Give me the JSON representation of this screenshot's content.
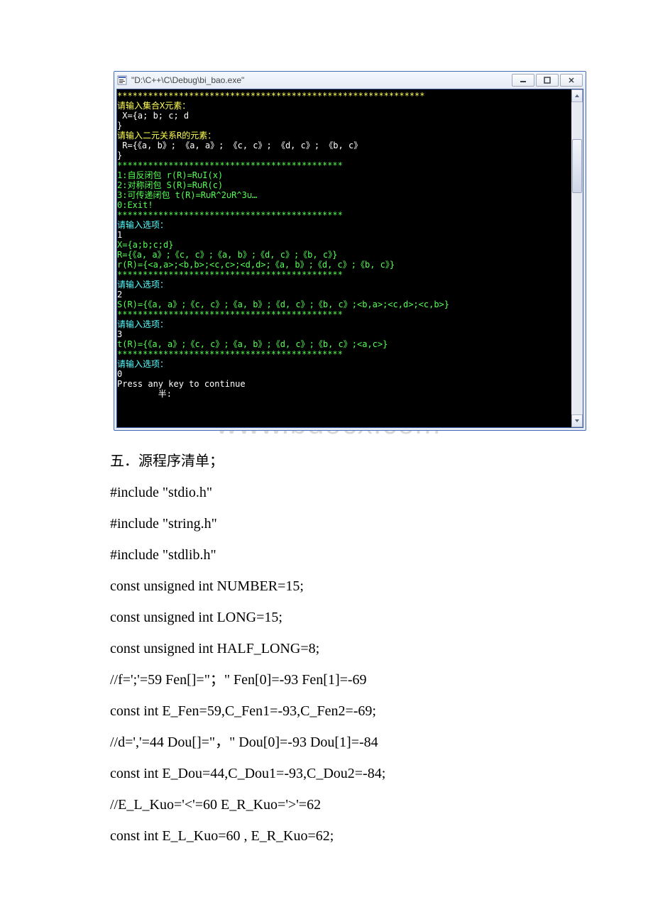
{
  "window": {
    "title": "\"D:\\C++\\C\\Debug\\bi_bao.exe\""
  },
  "console": {
    "l1": "************************************************************",
    "l2": "请输入集合X元素：",
    "l3": " X={a; b; c; d",
    "l4": "}",
    "l5": "请输入二元关系R的元素：",
    "l6": " R={《a, b》; 《a, a》; 《c, c》; 《d, c》; 《b, c》",
    "l7": "}",
    "l8": "********************************************",
    "l9": "1:自反闭包 r(R)=R∪I(x)",
    "l10": "2:对称闭包 S(R)=R∪R(c)",
    "l11": "3:可传递闭包 t(R)=R∪R^2∪R^3∪…",
    "l12": "0:Exit!",
    "l13": "********************************************",
    "l14": "请输入选项：",
    "l15": "1",
    "l16": "X={a;b;c;d}",
    "l17": "R={《a, a》;《c, c》;《a, b》;《d, c》;《b, c》}",
    "l18": "r(R)={<a,a>;<b,b>;<c,c>;<d,d>;《a, b》;《d, c》;《b, c》}",
    "l19": "********************************************",
    "l20": "请输入选项：",
    "l21": "2",
    "l22": "S(R)={《a, a》;《c, c》;《a, b》;《d, c》;《b, c》;<b,a>;<c,d>;<c,b>}",
    "l23": "********************************************",
    "l24": "请输入选项：",
    "l25": "3",
    "l26": "t(R)={《a, a》;《c, c》;《a, b》;《d, c》;《b, c》;<a,c>}",
    "l27": "********************************************",
    "l28": "请输入选项：",
    "l29": "0",
    "l30": "Press any key to continue",
    "l31": "        半:"
  },
  "watermark": "www.bdocx.com",
  "doc": {
    "heading": "五．源程序清单；",
    "p1": "#include \"stdio.h\"",
    "p2": "#include \"string.h\"",
    "p3": "#include \"stdlib.h\"",
    "p4": "const unsigned int NUMBER=15;",
    "p5": "const unsigned int LONG=15;",
    "p6": "const unsigned int HALF_LONG=8;",
    "p7": "//f=';'=59 Fen[]=\"；\" Fen[0]=-93 Fen[1]=-69",
    "p8": "const int E_Fen=59,C_Fen1=-93,C_Fen2=-69;",
    "p9": "//d=','=44 Dou[]=\"，\" Dou[0]=-93 Dou[1]=-84",
    "p10": "const int E_Dou=44,C_Dou1=-93,C_Dou2=-84;",
    "p11": "//E_L_Kuo='<'=60 E_R_Kuo='>'=62",
    "p12": "const int E_L_Kuo=60 , E_R_Kuo=62;"
  }
}
